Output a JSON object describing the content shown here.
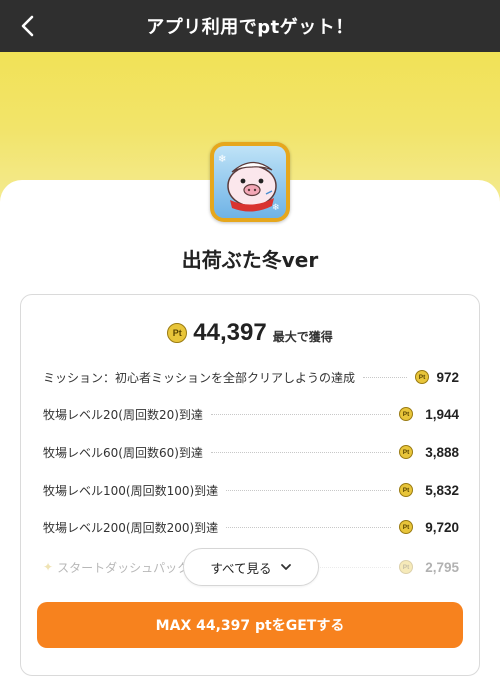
{
  "header": {
    "title": "アプリ利用でptゲット！"
  },
  "app": {
    "name": "出荷ぶた冬ver"
  },
  "reward": {
    "total": "44,397",
    "suffix": "最大で獲得",
    "coin_text": "Pt"
  },
  "missions": [
    {
      "label": "ミッション：初心者ミッションを全部クリアしようの達成",
      "points": "972"
    },
    {
      "label": "牧場レベル20(周回数20)到達",
      "points": "1,944"
    },
    {
      "label": "牧場レベル60(周回数60)到達",
      "points": "3,888"
    },
    {
      "label": "牧場レベル100(周回数100)到達",
      "points": "5,832"
    },
    {
      "label": "牧場レベル200(周回数200)到達",
      "points": "9,720"
    },
    {
      "label": "スタートダッシュパック",
      "points": "2,795"
    }
  ],
  "see_all": {
    "label": "すべて見る"
  },
  "cta": {
    "label": "MAX 44,397 ptをGETする"
  },
  "colors": {
    "header_bg": "#2f2f2f",
    "banner_yellow": "#f1e257",
    "cta_orange": "#f7821e",
    "coin_gold": "#e8c53a"
  },
  "icons": {
    "back": "chevron-left-icon",
    "coin": "pt-coin-icon",
    "see_all_arrow": "chevron-down-icon",
    "sparkle": "sparkle-icon"
  }
}
